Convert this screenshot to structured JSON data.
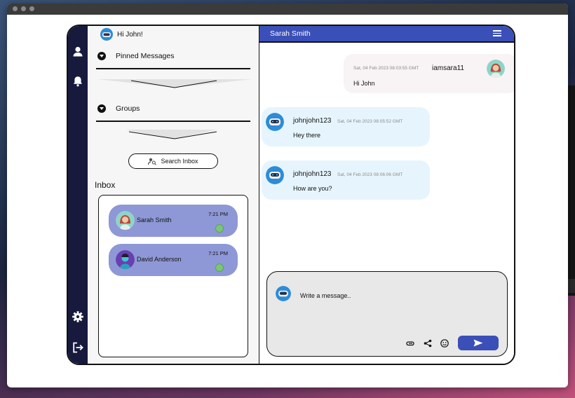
{
  "app": {
    "greeting": "Hi John!",
    "sections": {
      "pinned": "Pinned Messages",
      "groups": "Groups"
    },
    "search_button": "Search Inbox",
    "inbox_title": "Inbox"
  },
  "contacts": [
    {
      "name": "Sarah Smith",
      "time": "7:21 PM"
    },
    {
      "name": "David Anderson",
      "time": "7:21 PM"
    }
  ],
  "chat": {
    "title": "Sarah Smith",
    "messages": [
      {
        "user": "iamsara11",
        "timestamp": "Sat, 04 Feb 2023 08:03:55 GMT",
        "text": "Hi John"
      },
      {
        "user": "johnjohn123",
        "timestamp": "Sat, 04 Feb 2023 08:05:52 GMT",
        "text": "Hey there"
      },
      {
        "user": "johnjohn123",
        "timestamp": "Sat, 04 Feb 2023 08:06:06 GMT",
        "text": "How are you?"
      }
    ],
    "composer_placeholder": "Write a message.."
  },
  "icons": {
    "rail": [
      "user-icon",
      "bell-icon",
      "gear-icon",
      "logout-icon"
    ],
    "composer": [
      "paperclip-icon",
      "share-icon",
      "emoji-icon",
      "send-icon"
    ],
    "menu": "hamburger-menu-icon"
  },
  "colors": {
    "rail": "#171a3d",
    "accent": "#3b4fb8",
    "contact_bubble": "#8e98d6",
    "incoming_bubble": "#e6f5fd",
    "outgoing_bubble": "#f8f3f4",
    "online": "#7cc47a"
  }
}
